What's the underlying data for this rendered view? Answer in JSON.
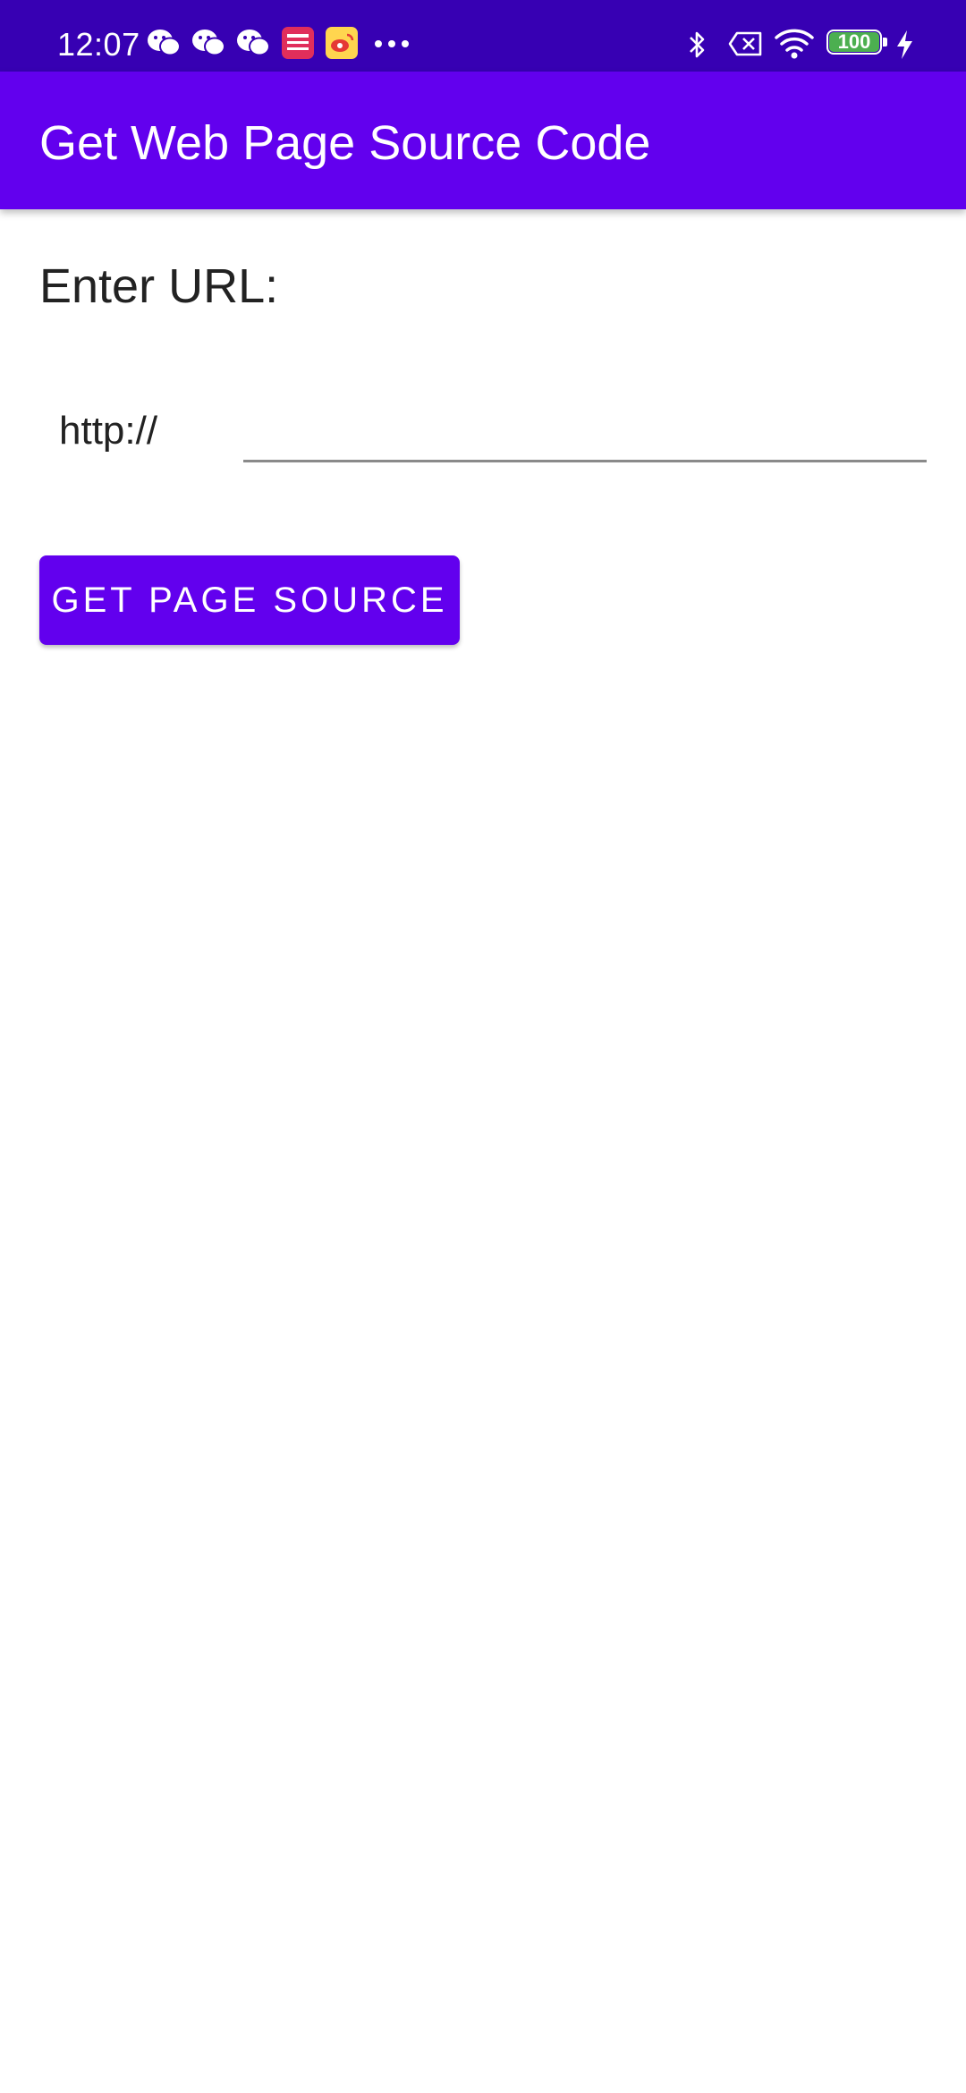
{
  "status_bar": {
    "time": "12:07",
    "battery_level": "100",
    "notification_icons": [
      "wechat-icon",
      "wechat-icon",
      "wechat-icon",
      "pinduoduo-app-icon",
      "weibo-app-icon",
      "more-dots-icon"
    ],
    "system_icons": [
      "bluetooth-icon",
      "no-sim-icon",
      "wifi-icon",
      "battery-icon",
      "charging-icon"
    ],
    "colors": {
      "background": "#3700b3",
      "battery_fill": "#4caf50"
    }
  },
  "app_bar": {
    "title": "Get Web Page Source Code",
    "color": "#6200ee"
  },
  "form": {
    "label": "Enter URL:",
    "prefix": "http://",
    "url_value": "",
    "button_label": "GET PAGE SOURCE",
    "button_color": "#6200ee"
  }
}
